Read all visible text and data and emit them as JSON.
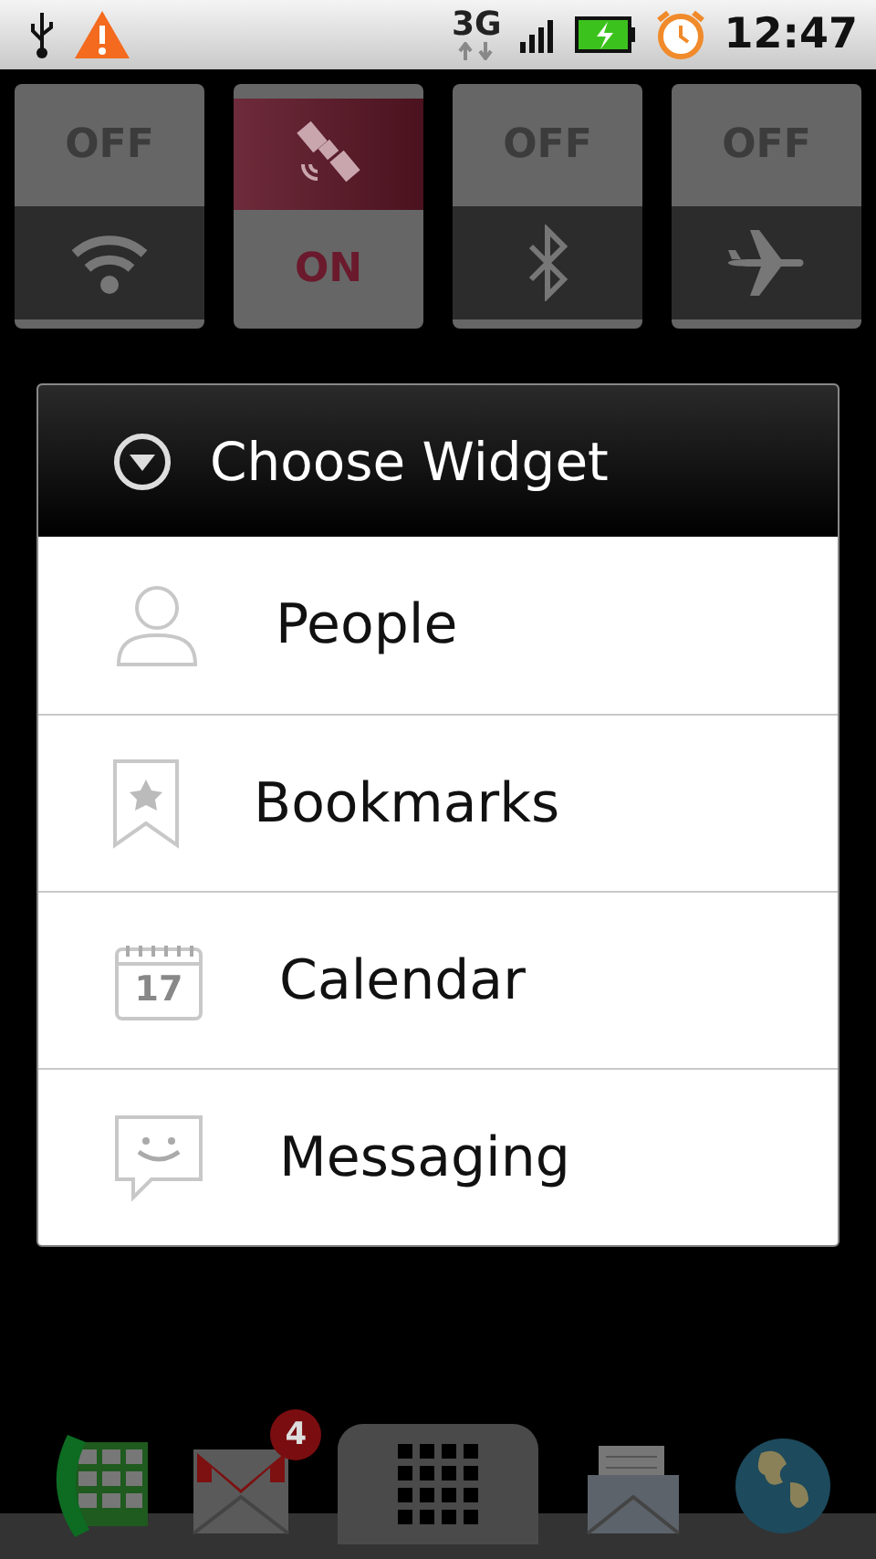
{
  "status_bar": {
    "network": "3G",
    "time": "12:47"
  },
  "toggles": [
    {
      "kind": "wifi",
      "label": "OFF",
      "on": false
    },
    {
      "kind": "gps",
      "label": "ON",
      "on": true
    },
    {
      "kind": "bluetooth",
      "label": "OFF",
      "on": false
    },
    {
      "kind": "airplane",
      "label": "OFF",
      "on": false
    }
  ],
  "dialog": {
    "title": "Choose Widget",
    "items": [
      {
        "kind": "people",
        "label": "People"
      },
      {
        "kind": "bookmarks",
        "label": "Bookmarks"
      },
      {
        "kind": "calendar",
        "label": "Calendar",
        "icon_text": "17"
      },
      {
        "kind": "messaging",
        "label": "Messaging"
      }
    ]
  },
  "dock": {
    "items": [
      {
        "kind": "phone"
      },
      {
        "kind": "gmail",
        "badge": "4"
      },
      {
        "kind": "launcher"
      },
      {
        "kind": "email"
      },
      {
        "kind": "browser"
      }
    ]
  }
}
